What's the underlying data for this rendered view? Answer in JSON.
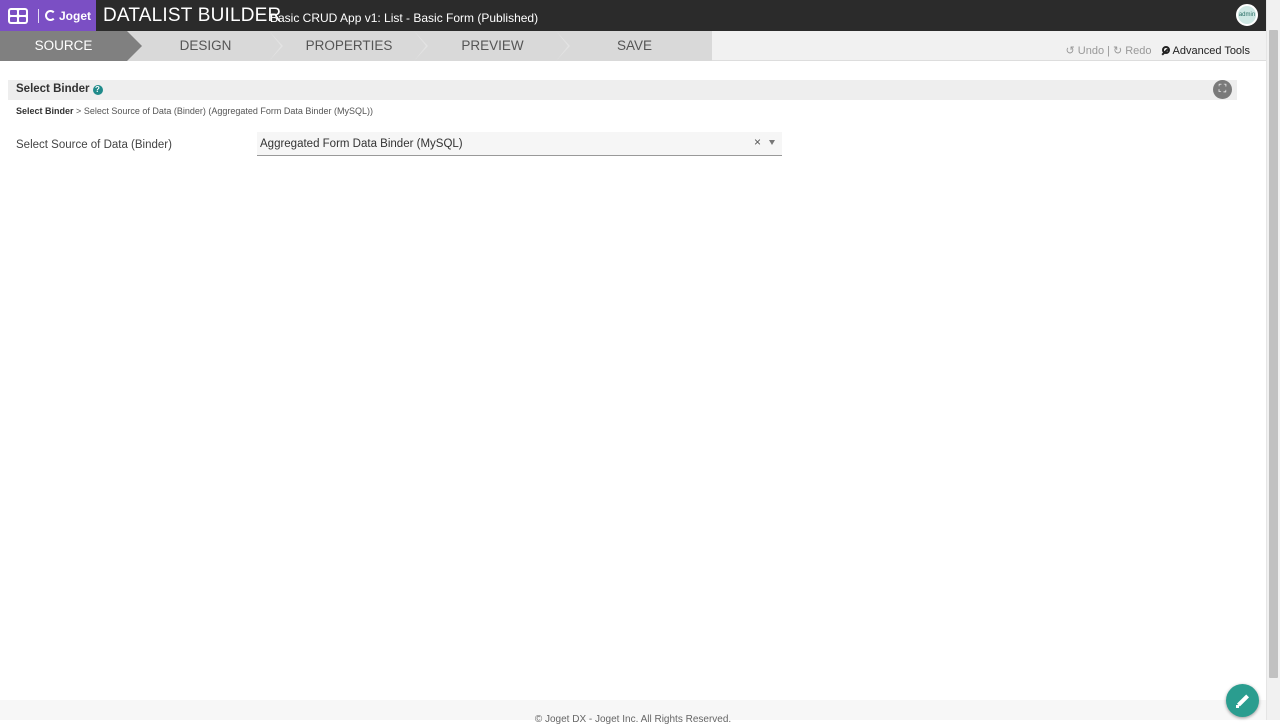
{
  "header": {
    "brand": "Joget",
    "title": "DATALIST BUILDER",
    "subtitle": "Basic CRUD App v1: List - Basic Form (Published)",
    "avatar_text": "admin"
  },
  "steps": [
    {
      "label": "SOURCE",
      "active": true
    },
    {
      "label": "DESIGN",
      "active": false
    },
    {
      "label": "PROPERTIES",
      "active": false
    },
    {
      "label": "PREVIEW",
      "active": false
    },
    {
      "label": "SAVE",
      "active": false
    }
  ],
  "tools": {
    "undo": "Undo",
    "separator": "|",
    "redo": "Redo",
    "advanced": "Advanced Tools"
  },
  "section": {
    "title": "Select Binder",
    "help": "?"
  },
  "breadcrumb": {
    "root": "Select Binder",
    "sep": ">",
    "current": "Select Source of Data (Binder) (Aggregated Form Data Binder (MySQL))"
  },
  "form": {
    "label": "Select Source of Data (Binder)",
    "value": "Aggregated Form Data Binder (MySQL)",
    "clear": "×"
  },
  "footer": {
    "text": "© Joget DX - Joget Inc. All Rights Reserved."
  },
  "colors": {
    "brand": "#7b4fc4",
    "topbar": "#2b2b2b",
    "active_step": "#808080",
    "accent": "#2a9d8f"
  }
}
